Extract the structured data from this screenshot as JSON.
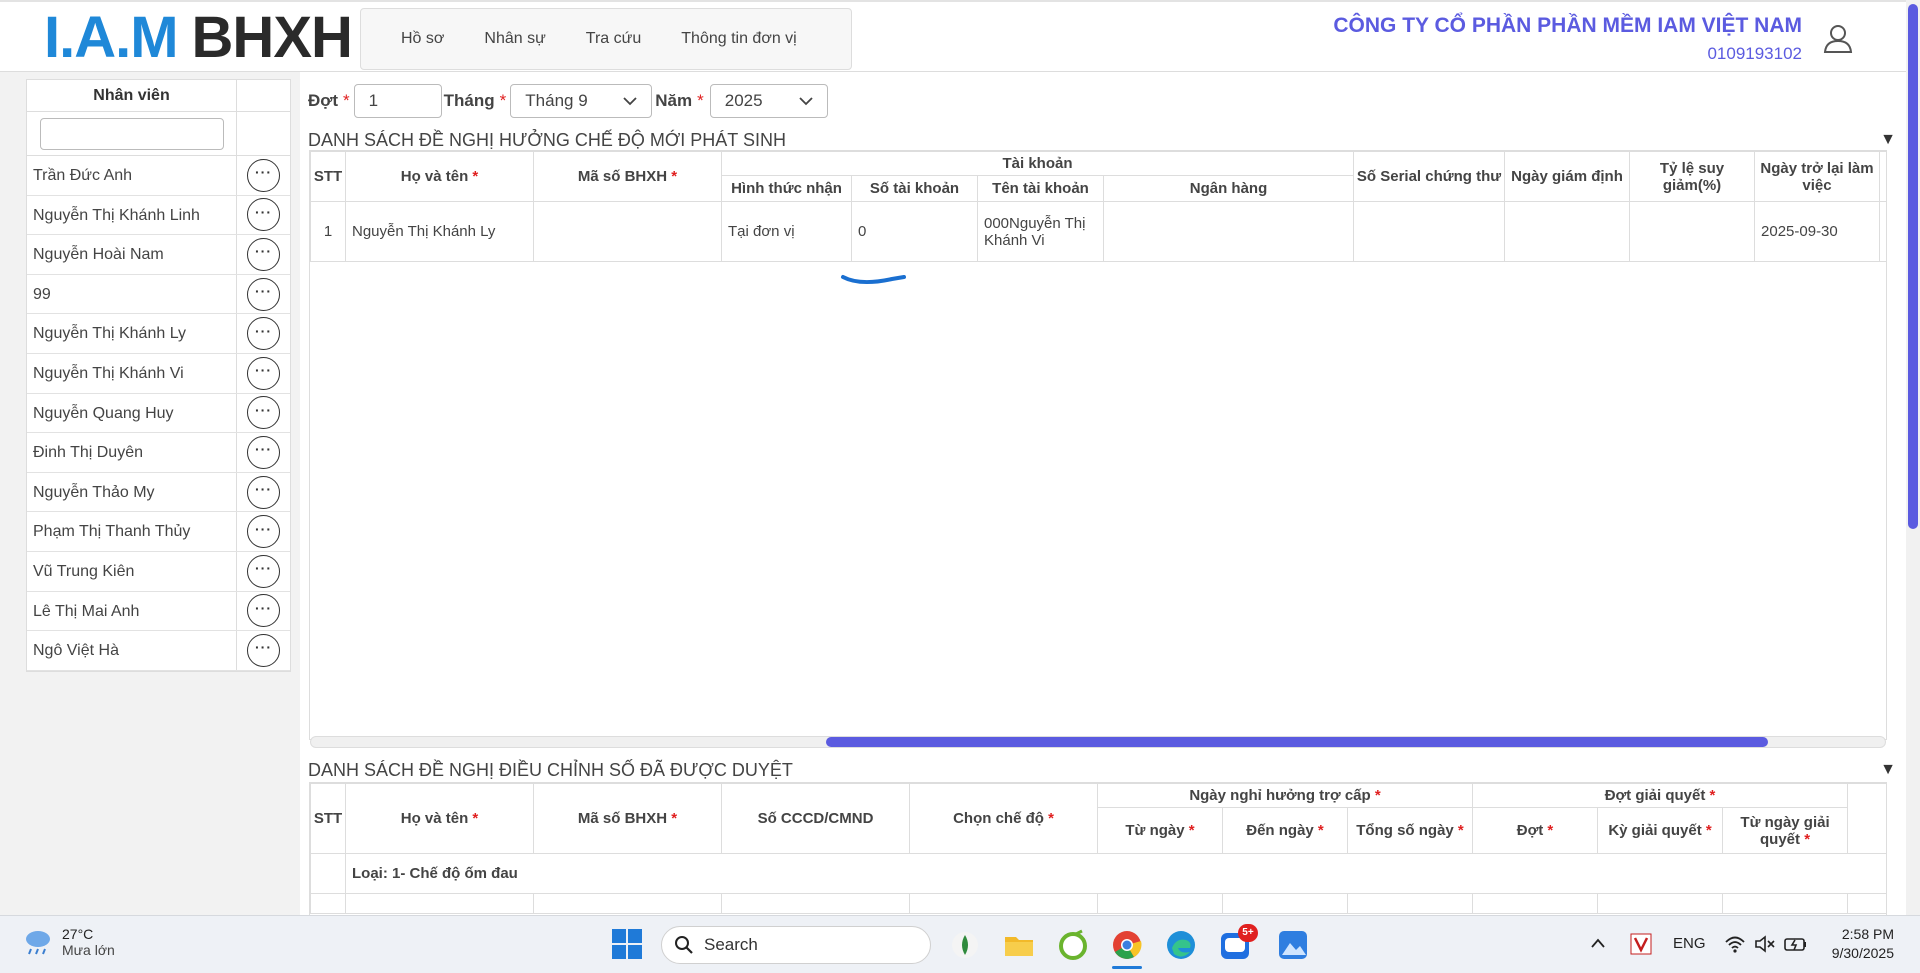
{
  "header": {
    "logo_iam": "I.A.M",
    "logo_bhxh": "BHXH",
    "nav": [
      "Hồ sơ",
      "Nhân sự",
      "Tra cứu",
      "Thông tin đơn vị"
    ],
    "company_name": "CÔNG TY CỔ PHẦN PHẦN MỀM IAM VIỆT NAM",
    "company_tax": "0109193102"
  },
  "employees": {
    "header": "Nhân viên",
    "items": [
      "Trần Đức Anh",
      "Nguyễn Thị Khánh Linh",
      "Nguyễn Hoài Nam",
      "99",
      "Nguyễn Thị Khánh Ly",
      "Nguyễn Thị Khánh Vi",
      "Nguyễn Quang Huy",
      "Đinh Thị Duyên",
      "Nguyễn Thảo My",
      "Phạm Thị Thanh Thủy",
      "Vũ Trung Kiên",
      "Lê Thị Mai Anh",
      "Ngô Việt Hà"
    ],
    "more_glyph": "···"
  },
  "filters": {
    "dot_label": "Đợt",
    "dot_value": "1",
    "month_label": "Tháng",
    "month_value": "Tháng 9",
    "year_label": "Năm",
    "year_value": "2025",
    "required": "*"
  },
  "section1": {
    "title": "DANH SÁCH ĐỀ NGHỊ HƯỞNG CHẾ ĐỘ MỚI PHÁT SINH",
    "headers": {
      "stt": "STT",
      "ho_ten": "Họ và tên",
      "ma_so": "Mã số BHXH",
      "tai_khoan": "Tài khoản",
      "hinh_thuc": "Hình thức nhận",
      "so_tk": "Số tài khoản",
      "ten_tk": "Tên tài khoản",
      "ngan_hang": "Ngân hàng",
      "serial": "Số Serial chứng thư",
      "ngay_giam_dinh": "Ngày giám định",
      "ty_le": "Tỷ lệ suy giảm(%)",
      "ngay_tro_lai": "Ngày trở lại làm việc"
    },
    "rows": [
      {
        "stt": "1",
        "ho_ten": "Nguyễn Thị Khánh Ly",
        "ma_so": "",
        "hinh_thuc": "Tại đơn vị",
        "so_tk": "0",
        "ten_tk": "000Nguyễn Thị Khánh Vi",
        "ngan_hang": "",
        "serial": "",
        "ngay_giam_dinh": "",
        "ty_le": "",
        "ngay_tro_lai": "2025-09-30"
      }
    ],
    "toggle": "▼"
  },
  "section2": {
    "title": "DANH SÁCH ĐỀ NGHỊ ĐIỀU CHỈNH SỐ ĐÃ ĐƯỢC DUYỆT",
    "headers": {
      "stt": "STT",
      "ho_ten": "Họ và tên",
      "ma_so": "Mã số BHXH",
      "cccd": "Số CCCD/CMND",
      "che_do": "Chọn chế độ",
      "ngay_nghi": "Ngày nghỉ hưởng trợ cấp",
      "tu_ngay": "Từ ngày",
      "den_ngay": "Đến ngày",
      "tong_so_ngay": "Tổng số ngày",
      "dot_gq": "Đợt giải quyết",
      "dot": "Đợt",
      "ky_gq": "Kỳ giải quyết",
      "tu_ngay_gq": "Từ ngày giải quyết"
    },
    "group_row": "Loại: 1- Chế độ ốm đau",
    "toggle": "▼"
  },
  "taskbar": {
    "temp": "27°C",
    "weather": "Mưa lớn",
    "search": "Search",
    "lang": "ENG",
    "badge": "5+",
    "time": "2:58 PM",
    "date": "9/30/2025"
  },
  "colors": {
    "accent": "#5b5be0",
    "logo_blue": "#1f88d8",
    "required": "#e02020"
  }
}
